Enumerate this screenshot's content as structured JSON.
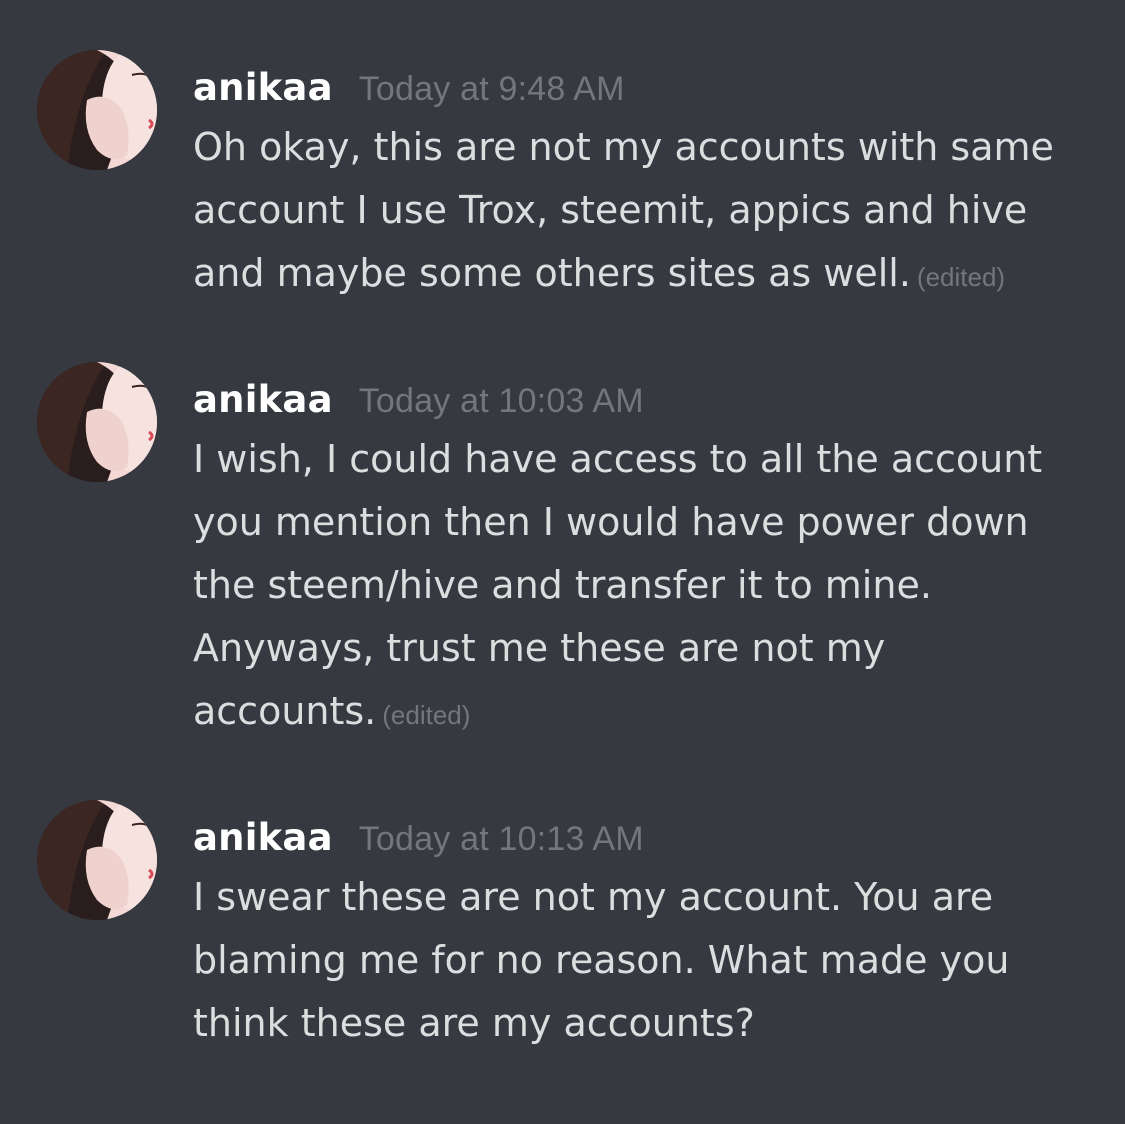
{
  "colors": {
    "background": "#36393f",
    "username": "#ffffff",
    "message_text": "#dcddde",
    "muted": "#72767d"
  },
  "messages": [
    {
      "username": "anikaa",
      "timestamp": "Today at 9:48 AM",
      "lines": [
        "Oh okay, this are not my accounts with same",
        "account I use Trox, steemit, appics and hive",
        "and maybe some others sites as well."
      ],
      "edited": "(edited)"
    },
    {
      "username": "anikaa",
      "timestamp": "Today at 10:03 AM",
      "lines": [
        "I wish, I could have access to all the account",
        "you mention then I would have power down",
        "the steem/hive and transfer it to mine.",
        "Anyways, trust me these are not my",
        "accounts."
      ],
      "edited": "(edited)"
    },
    {
      "username": "anikaa",
      "timestamp": "Today at 10:13 AM",
      "lines": [
        "I swear these are not my account. You are",
        "blaming me for no reason. What made you",
        "think these are my accounts?"
      ]
    }
  ]
}
